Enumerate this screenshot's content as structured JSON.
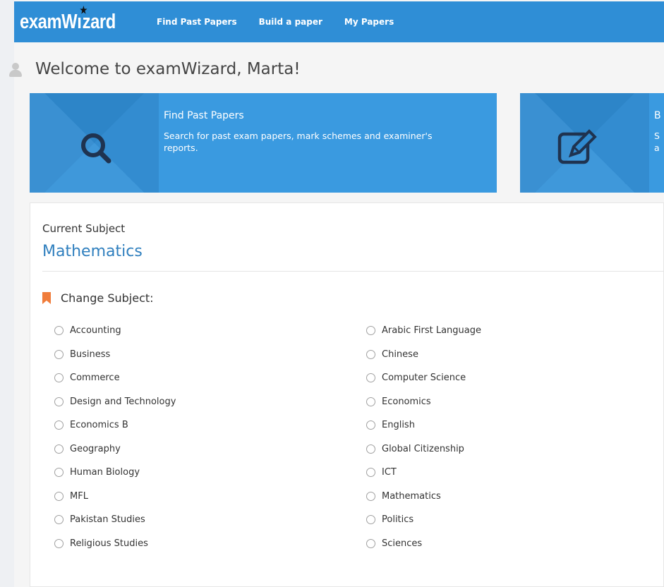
{
  "brand": {
    "logo_prefix": "examW",
    "logo_star": "★",
    "logo_suffix": "zard"
  },
  "nav": {
    "items": [
      "Find Past Papers",
      "Build a paper",
      "My Papers"
    ]
  },
  "welcome": {
    "text": "Welcome to examWizard, Marta!",
    "icon": "user-icon"
  },
  "tiles": [
    {
      "icon": "search-icon",
      "title": "Find Past Papers",
      "description": "Search for past exam papers, mark schemes and examiner's reports."
    },
    {
      "icon": "edit-icon",
      "title": "B",
      "description": "S a"
    }
  ],
  "subject": {
    "current_label": "Current Subject",
    "current_value": "Mathematics",
    "change_label": "Change Subject:",
    "change_icon": "bookmark-icon",
    "column_1": [
      "Accounting",
      "Business",
      "Commerce",
      "Design and Technology",
      "Economics B",
      "Geography",
      "Human Biology",
      "MFL",
      "Pakistan Studies",
      "Religious Studies"
    ],
    "column_2": [
      "Arabic First Language",
      "Chinese",
      "Computer Science",
      "Economics",
      "English",
      "Global Citizenship",
      "ICT",
      "Mathematics",
      "Politics",
      "Sciences"
    ]
  },
  "colors": {
    "nav_bg": "#2f8ed6",
    "tile_bg": "#3a9ae0",
    "accent_text": "#2f7fbe",
    "bookmark": "#f07c3a"
  }
}
